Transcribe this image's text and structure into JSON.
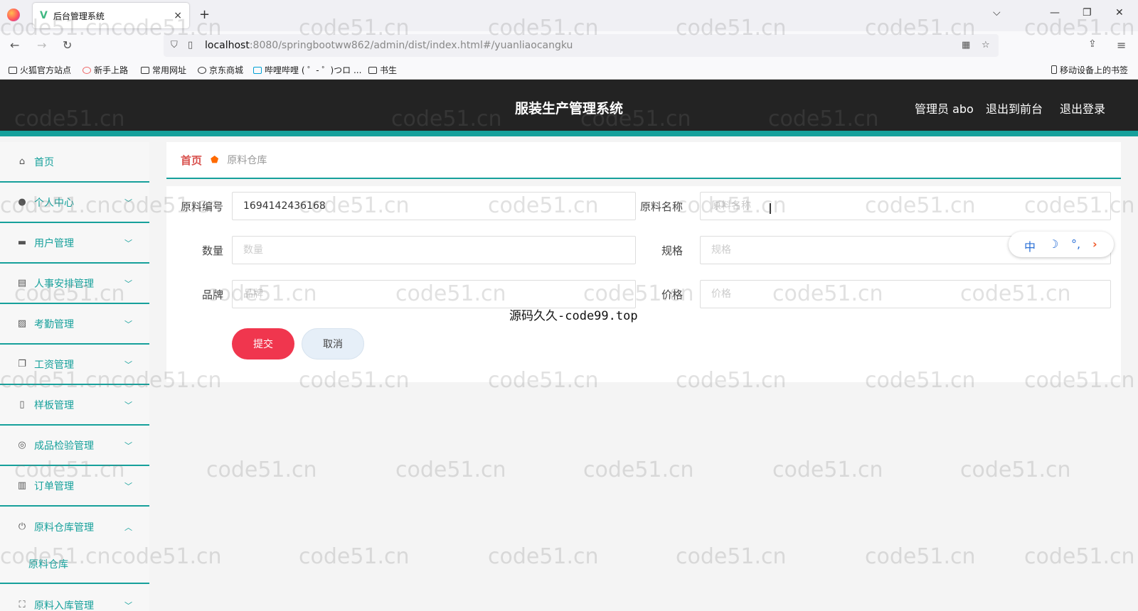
{
  "browser": {
    "tab_title": "后台管理系统",
    "tab_close": "×",
    "new_tab": "+",
    "url_host": "localhost",
    "url_rest": ":8080/springbootww862/admin/dist/index.html#/yuanliaocangku",
    "bookmarks": [
      "火狐官方站点",
      "新手上路",
      "常用网址",
      "京东商城",
      "哔哩哔哩 ( ゜- ゜)つロ ...",
      "书生"
    ],
    "mobile_bookmarks": "移动设备上的书签"
  },
  "header": {
    "title": "服装生产管理系统",
    "admin": "管理员 abo",
    "to_front": "退出到前台",
    "logout": "退出登录"
  },
  "sidebar": {
    "items": [
      {
        "label": "首页",
        "icon": "home-icon"
      },
      {
        "label": "个人中心",
        "icon": "user-icon"
      },
      {
        "label": "用户管理",
        "icon": "briefcase-icon"
      },
      {
        "label": "人事安排管理",
        "icon": "clipboard-icon"
      },
      {
        "label": "考勤管理",
        "icon": "chart-icon"
      },
      {
        "label": "工资管理",
        "icon": "copy-icon"
      },
      {
        "label": "样板管理",
        "icon": "phone-icon"
      },
      {
        "label": "成品检验管理",
        "icon": "compass-icon"
      },
      {
        "label": "订单管理",
        "icon": "book-icon"
      },
      {
        "label": "原料仓库管理",
        "icon": "power-icon"
      },
      {
        "label": "原料入库管理",
        "icon": "fullscreen-icon"
      }
    ],
    "sub_item": "原料仓库"
  },
  "breadcrumb": {
    "home": "首页",
    "current": "原料仓库"
  },
  "form": {
    "code_label": "原料编号",
    "code_value": "1694142436168",
    "name_label": "原料名称",
    "name_placeholder": "原料名称",
    "qty_label": "数量",
    "qty_placeholder": "数量",
    "spec_label": "规格",
    "spec_placeholder": "规格",
    "brand_label": "品牌",
    "brand_placeholder": "品牌",
    "price_label": "价格",
    "price_placeholder": "价格",
    "submit": "提交",
    "cancel": "取消"
  },
  "ime": {
    "mode": "中",
    "moon": "☽",
    "dots": "°,",
    "arrow": "›"
  },
  "overlay": "源码久久-code99.top",
  "watermark": "code51.cn",
  "colors": {
    "accent": "#16a09b",
    "submit": "#f0364e",
    "header": "#232323"
  }
}
